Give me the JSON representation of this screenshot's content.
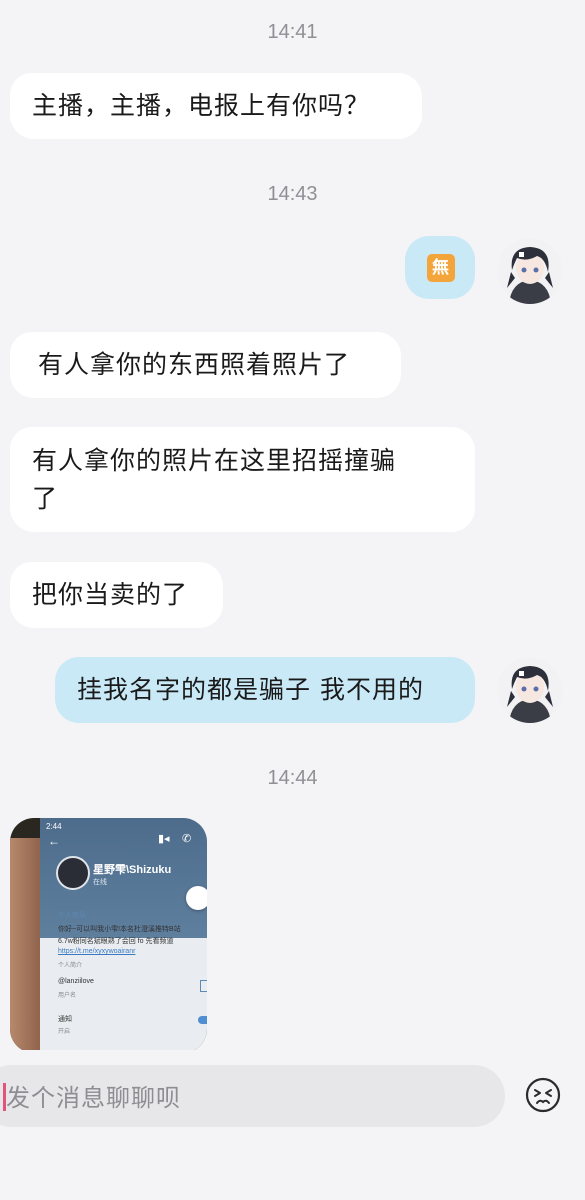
{
  "timestamps": [
    "14:41",
    "14:43",
    "14:44"
  ],
  "messages": [
    {
      "side": "incoming",
      "text": "主播，主播，电报上有你吗？"
    },
    {
      "side": "outgoing",
      "text": "無",
      "type": "sticker-emoji"
    },
    {
      "side": "incoming",
      "text": "有人拿你的东西照着照片了"
    },
    {
      "side": "incoming",
      "text_line1": "有人拿你的照片在这里招摇撞骗",
      "text_line2": "了"
    },
    {
      "side": "incoming",
      "text": "把你当卖的了"
    },
    {
      "side": "outgoing",
      "text": "挂我名字的都是骗子 我不用的"
    },
    {
      "side": "incoming",
      "type": "image"
    }
  ],
  "photo": {
    "time": "2:44",
    "name": "星野雫\\Shizuku",
    "status": "在线",
    "section": "个人信息",
    "bio_line1": "你好~可以叫我小雫!本名杜澄溪推特B站",
    "bio_line2": "6.7w粉同名斌眼熟了会回 fo 先看频道",
    "link": "https://t.me/xyxywoairanr",
    "bio_label": "个人简介",
    "username": "@lanziilove",
    "username_label": "用户名",
    "notify": "通知",
    "notify_state": "开启"
  },
  "composer": {
    "placeholder": "发个消息聊聊呗",
    "emoji_icon": "emoji-face-icon"
  },
  "colors": {
    "background": "#f4f4f7",
    "incoming_bubble": "#ffffff",
    "outgoing_bubble": "#c9e9f7",
    "sticker": "#f3a43b",
    "caret": "#e5527a"
  }
}
